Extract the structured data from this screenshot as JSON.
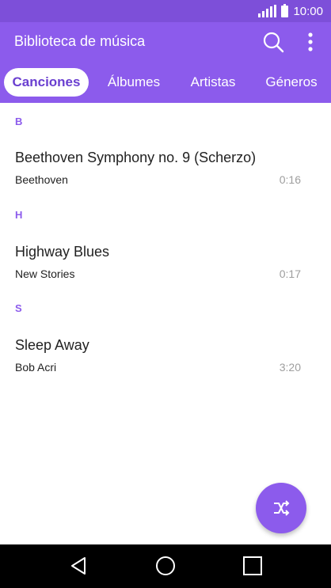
{
  "status_bar": {
    "time": "10:00",
    "icons": [
      "signal-icon",
      "battery-icon"
    ]
  },
  "app_bar": {
    "title": "Biblioteca de música",
    "color": "#8c5bec",
    "actions": [
      "search-icon",
      "more-vertical-icon"
    ]
  },
  "tabs": [
    {
      "label": "Canciones",
      "active": true
    },
    {
      "label": "Álbumes",
      "active": false
    },
    {
      "label": "Artistas",
      "active": false
    },
    {
      "label": "Géneros",
      "active": false
    }
  ],
  "sections": [
    {
      "letter": "B",
      "songs": [
        {
          "title": "Beethoven Symphony no. 9 (Scherzo)",
          "artist": "Beethoven",
          "duration": "0:16"
        }
      ]
    },
    {
      "letter": "H",
      "songs": [
        {
          "title": "Highway Blues",
          "artist": "New Stories",
          "duration": "0:17"
        }
      ]
    },
    {
      "letter": "S",
      "songs": [
        {
          "title": "Sleep Away",
          "artist": "Bob Acri",
          "duration": "3:20"
        }
      ]
    }
  ],
  "fab": {
    "icon": "shuffle-icon"
  },
  "nav_bar": {
    "icons": [
      "back-icon",
      "home-icon",
      "recents-icon"
    ]
  }
}
